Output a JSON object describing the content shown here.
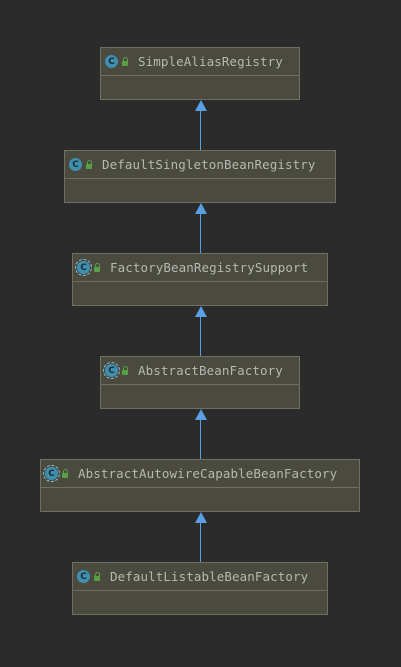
{
  "diagram": {
    "classes": [
      {
        "name": "SimpleAliasRegistry",
        "kind": "class",
        "icon_letter": "C",
        "icon": "class-icon"
      },
      {
        "name": "DefaultSingletonBeanRegistry",
        "kind": "class",
        "icon_letter": "C",
        "icon": "class-icon"
      },
      {
        "name": "FactoryBeanRegistrySupport",
        "kind": "abstract-class",
        "icon_letter": "C",
        "icon": "abstract-class-icon"
      },
      {
        "name": "AbstractBeanFactory",
        "kind": "abstract-class",
        "icon_letter": "C",
        "icon": "abstract-class-icon"
      },
      {
        "name": "AbstractAutowireCapableBeanFactory",
        "kind": "abstract-class",
        "icon_letter": "C",
        "icon": "abstract-class-icon"
      },
      {
        "name": "DefaultListableBeanFactory",
        "kind": "class",
        "icon_letter": "C",
        "icon": "class-icon"
      }
    ],
    "relations": [
      {
        "from": "DefaultSingletonBeanRegistry",
        "to": "SimpleAliasRegistry",
        "type": "extends"
      },
      {
        "from": "FactoryBeanRegistrySupport",
        "to": "DefaultSingletonBeanRegistry",
        "type": "extends"
      },
      {
        "from": "AbstractBeanFactory",
        "to": "FactoryBeanRegistrySupport",
        "type": "extends"
      },
      {
        "from": "AbstractAutowireCapableBeanFactory",
        "to": "AbstractBeanFactory",
        "type": "extends"
      },
      {
        "from": "DefaultListableBeanFactory",
        "to": "AbstractAutowireCapableBeanFactory",
        "type": "extends"
      }
    ],
    "colors": {
      "background": "#2b2b2b",
      "box_fill": "#4a4a3f",
      "box_border": "#6f6f62",
      "text": "#b6b8b2",
      "arrow": "#5aa0e6",
      "class_icon": "#3f8fb0",
      "access_icon": "#58a045"
    }
  }
}
